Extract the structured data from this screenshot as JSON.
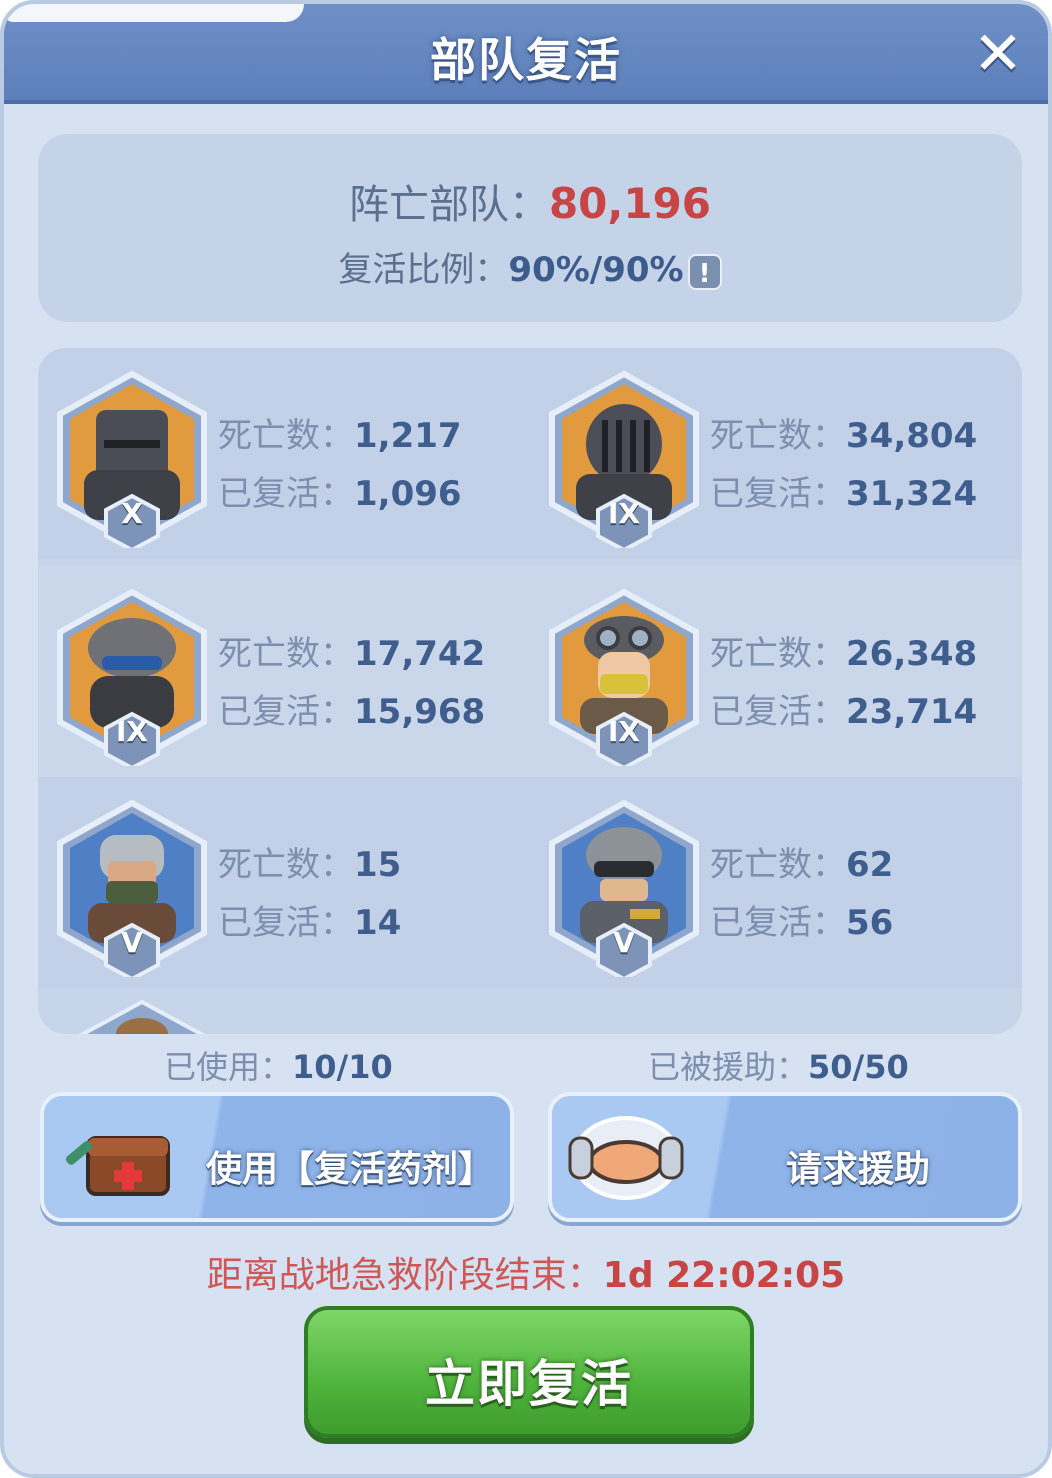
{
  "title": "部队复活",
  "close": "✕",
  "summary": {
    "dead_label": "阵亡部队：",
    "dead_value": "80,196",
    "ratio_label": "复活比例：",
    "ratio_value": "90%/90%",
    "info": "!"
  },
  "stat_labels": {
    "dead": "死亡数：",
    "revived": "已复活："
  },
  "units": [
    {
      "tier": "X",
      "dead": "1,217",
      "revived": "1,096"
    },
    {
      "tier": "IX",
      "dead": "34,804",
      "revived": "31,324"
    },
    {
      "tier": "IX",
      "dead": "17,742",
      "revived": "15,968"
    },
    {
      "tier": "IX",
      "dead": "26,348",
      "revived": "23,714"
    },
    {
      "tier": "V",
      "dead": "15",
      "revived": "14"
    },
    {
      "tier": "V",
      "dead": "62",
      "revived": "56"
    }
  ],
  "counters": {
    "used_label": "已使用：",
    "used_value": "10/10",
    "helped_label": "已被援助：",
    "helped_value": "50/50"
  },
  "buttons": {
    "use_potion": "使用【复活药剂】",
    "request_help": "请求援助",
    "revive_now": "立即复活"
  },
  "timer": {
    "label": "距离战地急救阶段结束：",
    "value": "1d 22:02:05"
  },
  "colors": {
    "header": "#5d7fbb",
    "panel": "#d6e2f1",
    "accent_red": "#c84545",
    "value_blue": "#3f5e8e",
    "green": "#4fb43b"
  }
}
